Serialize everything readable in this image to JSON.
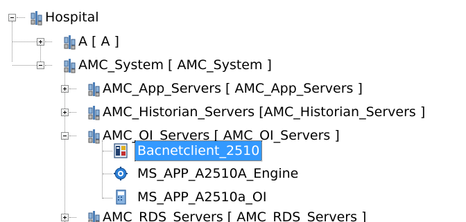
{
  "tree": {
    "nodes": [
      {
        "label": "Hospital",
        "icon": "area-icon",
        "expander": "minus"
      },
      {
        "label": "A [ A ]",
        "icon": "area-icon",
        "expander": "plus"
      },
      {
        "label": "AMC_System [ AMC_System ]",
        "icon": "area-icon",
        "expander": "minus"
      },
      {
        "label": "AMC_App_Servers [ AMC_App_Servers ]",
        "icon": "area-icon",
        "expander": "plus"
      },
      {
        "label": "AMC_Historian_Servers [AMC_Historian_Servers ]",
        "icon": "area-icon",
        "expander": "plus"
      },
      {
        "label": "AMC_OI_Servers [ AMC_OI_Servers ]",
        "icon": "area-icon",
        "expander": "minus"
      },
      {
        "label": "Bacnetclient_2510",
        "icon": "device-icon",
        "expander": "none",
        "selected": true
      },
      {
        "label": "MS_APP_A2510A_Engine",
        "icon": "engine-icon",
        "expander": "none"
      },
      {
        "label": "MS_APP_A2510a_OI",
        "icon": "oi-object-icon",
        "expander": "none"
      },
      {
        "label": "AMC_RDS_Servers [ AMC_RDS_Servers ]",
        "icon": "area-icon",
        "expander": "plus"
      }
    ]
  }
}
